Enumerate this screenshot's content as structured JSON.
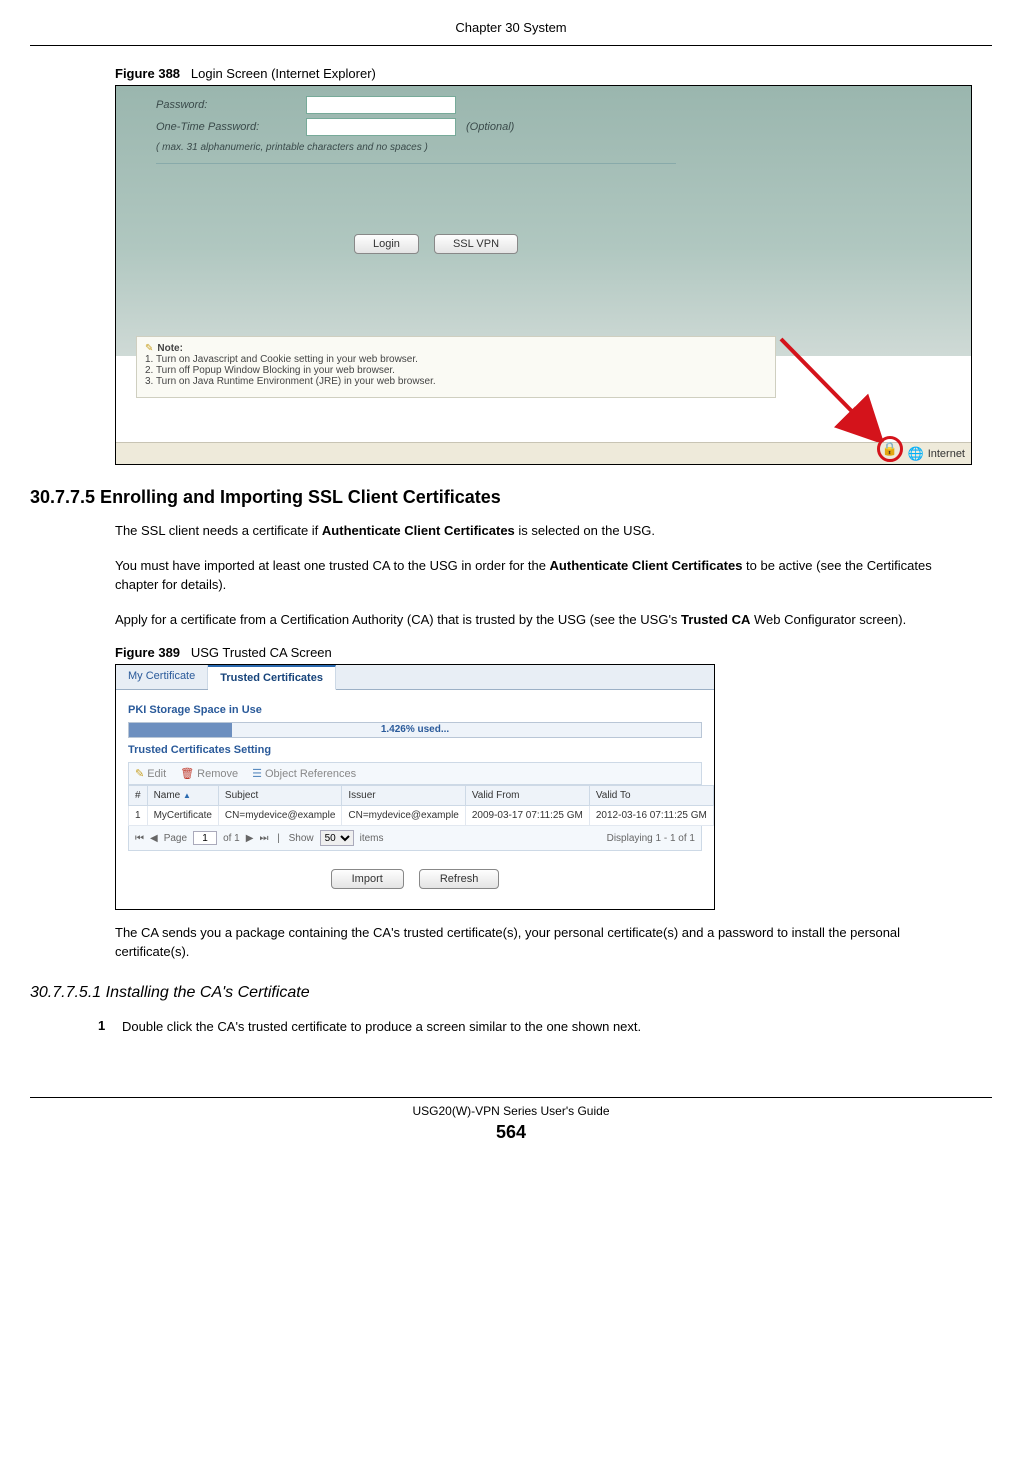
{
  "chapter": "Chapter 30 System",
  "fig388": {
    "caption_prefix": "Figure 388",
    "caption": "Login Screen (Internet Explorer)",
    "password_label": "Password:",
    "otp_label": "One-Time Password:",
    "optional": "(Optional)",
    "hint": "( max. 31 alphanumeric, printable characters and no spaces )",
    "login_btn": "Login",
    "sslvpn_btn": "SSL VPN",
    "note_hdr": "Note:",
    "note1": "1. Turn on Javascript and Cookie setting in your web browser.",
    "note2": "2. Turn off Popup Window Blocking in your web browser.",
    "note3": "3. Turn on Java Runtime Environment (JRE) in your web browser.",
    "zone": "Internet"
  },
  "sec": {
    "h1": "30.7.7.5  Enrolling and Importing SSL Client Certificates",
    "p1a": "The SSL client needs a certificate if ",
    "p1b": "Authenticate Client Certificates",
    "p1c": " is selected on the USG.",
    "p2a": "You must have imported at least one trusted CA to the USG in order for the ",
    "p2b": "Authenticate Client Certificates",
    "p2c": " to be active (see the Certificates chapter for details).",
    "p3a": "Apply for a certificate from a Certification Authority (CA) that is trusted by the USG (see the USG's ",
    "p3b": "Trusted CA",
    "p3c": " Web Configurator screen)."
  },
  "fig389": {
    "caption_prefix": "Figure 389",
    "caption": "USG Trusted CA Screen",
    "tab_my": "My Certificate",
    "tab_trusted": "Trusted Certificates",
    "pki_label": "PKI Storage Space in Use",
    "pki_used": "1.426% used...",
    "setting_label": "Trusted Certificates Setting",
    "tb_edit": "Edit",
    "tb_remove": "Remove",
    "tb_obj": "Object References",
    "cols": {
      "num": "#",
      "name": "Name",
      "subject": "Subject",
      "issuer": "Issuer",
      "from": "Valid From",
      "to": "Valid To"
    },
    "row": {
      "num": "1",
      "name": "MyCertificate",
      "subject": "CN=mydevice@example",
      "issuer": "CN=mydevice@example",
      "from": "2009-03-17 07:11:25 GM",
      "to": "2012-03-16 07:11:25 GM"
    },
    "pager": {
      "page_lbl": "Page",
      "page_val": "1",
      "of": "of 1",
      "show": "Show",
      "show_val": "50",
      "items": "items",
      "disp": "Displaying 1 - 1 of 1"
    },
    "btn_import": "Import",
    "btn_refresh": "Refresh"
  },
  "after389": "The CA sends you a package containing the CA's trusted certificate(s), your personal certificate(s) and a password to install the personal certificate(s).",
  "sub": {
    "h": "30.7.7.5.1  Installing the CA's Certificate",
    "step1_num": "1",
    "step1": "Double click the CA's trusted certificate to produce a screen similar to the one shown next."
  },
  "footer": {
    "guide": "USG20(W)-VPN Series User's Guide",
    "page": "564"
  }
}
